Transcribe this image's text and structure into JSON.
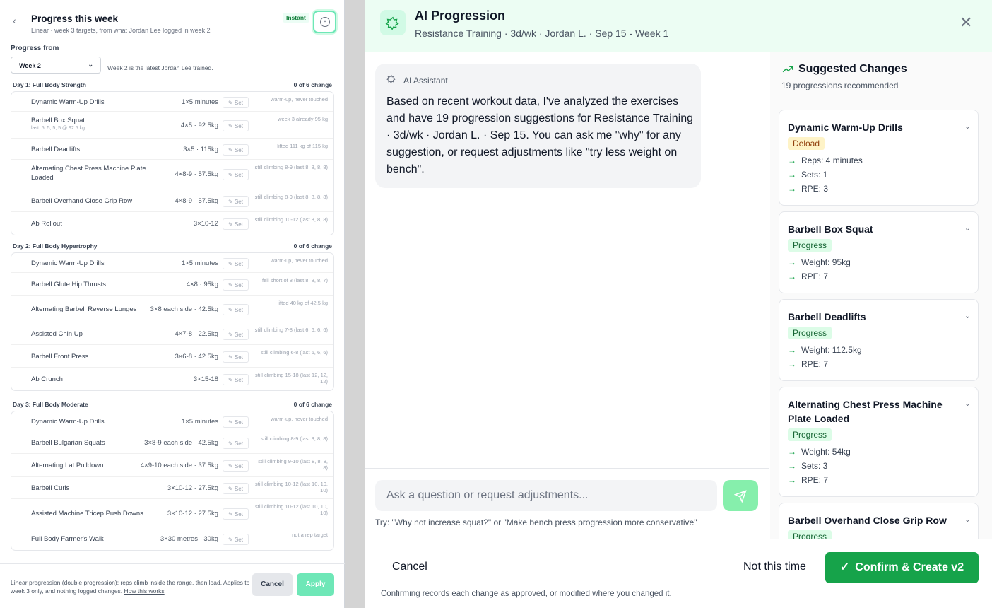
{
  "left": {
    "title": "Progress this week",
    "subtitle": "Linear · week 3 targets, from what Jordan Lee logged in week 2",
    "instant_badge": "Instant",
    "progress_from_label": "Progress from",
    "week_select": "Week 2",
    "week_note": "Week 2 is the latest Jordan Lee trained.",
    "set_label": "Set",
    "days": [
      {
        "name": "Day 1: Full Body Strength",
        "count": "0 of 6 change",
        "rows": [
          {
            "name": "Dynamic Warm-Up Drills",
            "last": "",
            "target": "1×5 minutes",
            "note": "warm-up, never touched"
          },
          {
            "name": "Barbell Box Squat",
            "last": "last: 5, 5, 5, 5 @ 92.5 kg",
            "target": "4×5 · 92.5kg",
            "note": "week 3 already 95 kg"
          },
          {
            "name": "Barbell Deadlifts",
            "last": "",
            "target": "3×5 · 115kg",
            "note": "lifted 111 kg of 115 kg"
          },
          {
            "name": "Alternating Chest Press Machine Plate Loaded",
            "last": "",
            "target": "4×8-9 · 57.5kg",
            "note": "still climbing 8-9 (last 8, 8, 8, 8)"
          },
          {
            "name": "Barbell Overhand Close Grip Row",
            "last": "",
            "target": "4×8-9 · 57.5kg",
            "note": "still climbing 8-9 (last 8, 8, 8, 8)"
          },
          {
            "name": "Ab Rollout",
            "last": "",
            "target": "3×10-12",
            "note": "still climbing 10-12 (last 8, 8, 8)"
          }
        ]
      },
      {
        "name": "Day 2: Full Body Hypertrophy",
        "count": "0 of 6 change",
        "rows": [
          {
            "name": "Dynamic Warm-Up Drills",
            "last": "",
            "target": "1×5 minutes",
            "note": "warm-up, never touched"
          },
          {
            "name": "Barbell Glute Hip Thrusts",
            "last": "",
            "target": "4×8 · 95kg",
            "note": "fell short of 8 (last 8, 8, 8, 7)"
          },
          {
            "name": "Alternating Barbell Reverse Lunges",
            "last": "",
            "target": "3×8 each side · 42.5kg",
            "note": "lifted 40 kg of 42.5 kg"
          },
          {
            "name": "Assisted Chin Up",
            "last": "",
            "target": "4×7-8 · 22.5kg",
            "note": "still climbing 7-8 (last 6, 6, 6, 6)"
          },
          {
            "name": "Barbell Front Press",
            "last": "",
            "target": "3×6-8 · 42.5kg",
            "note": "still climbing 6-8 (last 6, 6, 6)"
          },
          {
            "name": "Ab Crunch",
            "last": "",
            "target": "3×15-18",
            "note": "still climbing 15-18 (last 12, 12, 12)"
          }
        ]
      },
      {
        "name": "Day 3: Full Body Moderate",
        "count": "0 of 6 change",
        "rows": [
          {
            "name": "Dynamic Warm-Up Drills",
            "last": "",
            "target": "1×5 minutes",
            "note": "warm-up, never touched"
          },
          {
            "name": "Barbell Bulgarian Squats",
            "last": "",
            "target": "3×8-9 each side · 42.5kg",
            "note": "still climbing 8-9 (last 8, 8, 8)"
          },
          {
            "name": "Alternating Lat Pulldown",
            "last": "",
            "target": "4×9-10 each side · 37.5kg",
            "note": "still climbing 9-10 (last 8, 8, 8, 8)"
          },
          {
            "name": "Barbell Curls",
            "last": "",
            "target": "3×10-12 · 27.5kg",
            "note": "still climbing 10-12 (last 10, 10, 10)"
          },
          {
            "name": "Assisted Machine Tricep Push Downs",
            "last": "",
            "target": "3×10-12 · 27.5kg",
            "note": "still climbing 10-12 (last 10, 10, 10)"
          },
          {
            "name": "Full Body Farmer's Walk",
            "last": "",
            "target": "3×30 metres · 30kg",
            "note": "not a rep target"
          }
        ]
      }
    ],
    "footer_note": "Linear progression (double progression): reps climb inside the range, then load. Applies to week 3 only, and nothing logged changes.",
    "footer_link": "How this works",
    "cancel": "Cancel",
    "apply": "Apply"
  },
  "modal": {
    "title": "AI Progression",
    "subtitle": "Resistance Training · 3d/wk · Jordan L. · Sep 15 - Week 1",
    "assistant_label": "AI Assistant",
    "assistant_message": "Based on recent workout data, I've analyzed the exercises and have 19 progression suggestions for Resistance Training · 3d/wk · Jordan L. · Sep 15. You can ask me \"why\" for any suggestion, or request adjustments like \"try less weight on bench\".",
    "input_placeholder": "Ask a question or request adjustments...",
    "try_hint": "Try: \"Why not increase squat?\" or \"Make bench press progression more conservative\"",
    "suggested_title": "Suggested Changes",
    "suggested_sub": "19 progressions recommended",
    "cards": [
      {
        "name": "Dynamic Warm-Up Drills",
        "tag": "Deload",
        "changes": [
          "Reps: 4 minutes",
          "Sets: 1",
          "RPE: 3"
        ]
      },
      {
        "name": "Barbell Box Squat",
        "tag": "Progress",
        "changes": [
          "Weight: 95kg",
          "RPE: 7"
        ]
      },
      {
        "name": "Barbell Deadlifts",
        "tag": "Progress",
        "changes": [
          "Weight: 112.5kg",
          "RPE: 7"
        ]
      },
      {
        "name": "Alternating Chest Press Machine Plate Loaded",
        "tag": "Progress",
        "changes": [
          "Weight: 54kg",
          "Sets: 3",
          "RPE: 7"
        ]
      },
      {
        "name": "Barbell Overhand Close Grip Row",
        "tag": "Progress",
        "changes": []
      }
    ],
    "cancel": "Cancel",
    "not_this_time": "Not this time",
    "confirm": "Confirm & Create v2",
    "footer_note": "Confirming records each change as approved, or modified where you changed it."
  }
}
